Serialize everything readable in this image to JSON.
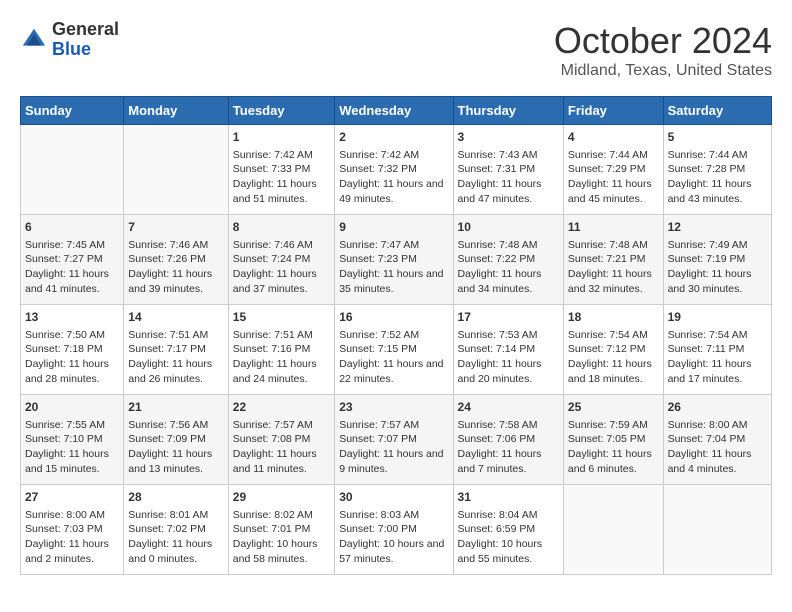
{
  "header": {
    "logo_general": "General",
    "logo_blue": "Blue",
    "month_title": "October 2024",
    "location": "Midland, Texas, United States"
  },
  "calendar": {
    "days_of_week": [
      "Sunday",
      "Monday",
      "Tuesday",
      "Wednesday",
      "Thursday",
      "Friday",
      "Saturday"
    ],
    "weeks": [
      [
        {
          "day": "",
          "content": ""
        },
        {
          "day": "",
          "content": ""
        },
        {
          "day": "1",
          "content": "Sunrise: 7:42 AM\nSunset: 7:33 PM\nDaylight: 11 hours and 51 minutes."
        },
        {
          "day": "2",
          "content": "Sunrise: 7:42 AM\nSunset: 7:32 PM\nDaylight: 11 hours and 49 minutes."
        },
        {
          "day": "3",
          "content": "Sunrise: 7:43 AM\nSunset: 7:31 PM\nDaylight: 11 hours and 47 minutes."
        },
        {
          "day": "4",
          "content": "Sunrise: 7:44 AM\nSunset: 7:29 PM\nDaylight: 11 hours and 45 minutes."
        },
        {
          "day": "5",
          "content": "Sunrise: 7:44 AM\nSunset: 7:28 PM\nDaylight: 11 hours and 43 minutes."
        }
      ],
      [
        {
          "day": "6",
          "content": "Sunrise: 7:45 AM\nSunset: 7:27 PM\nDaylight: 11 hours and 41 minutes."
        },
        {
          "day": "7",
          "content": "Sunrise: 7:46 AM\nSunset: 7:26 PM\nDaylight: 11 hours and 39 minutes."
        },
        {
          "day": "8",
          "content": "Sunrise: 7:46 AM\nSunset: 7:24 PM\nDaylight: 11 hours and 37 minutes."
        },
        {
          "day": "9",
          "content": "Sunrise: 7:47 AM\nSunset: 7:23 PM\nDaylight: 11 hours and 35 minutes."
        },
        {
          "day": "10",
          "content": "Sunrise: 7:48 AM\nSunset: 7:22 PM\nDaylight: 11 hours and 34 minutes."
        },
        {
          "day": "11",
          "content": "Sunrise: 7:48 AM\nSunset: 7:21 PM\nDaylight: 11 hours and 32 minutes."
        },
        {
          "day": "12",
          "content": "Sunrise: 7:49 AM\nSunset: 7:19 PM\nDaylight: 11 hours and 30 minutes."
        }
      ],
      [
        {
          "day": "13",
          "content": "Sunrise: 7:50 AM\nSunset: 7:18 PM\nDaylight: 11 hours and 28 minutes."
        },
        {
          "day": "14",
          "content": "Sunrise: 7:51 AM\nSunset: 7:17 PM\nDaylight: 11 hours and 26 minutes."
        },
        {
          "day": "15",
          "content": "Sunrise: 7:51 AM\nSunset: 7:16 PM\nDaylight: 11 hours and 24 minutes."
        },
        {
          "day": "16",
          "content": "Sunrise: 7:52 AM\nSunset: 7:15 PM\nDaylight: 11 hours and 22 minutes."
        },
        {
          "day": "17",
          "content": "Sunrise: 7:53 AM\nSunset: 7:14 PM\nDaylight: 11 hours and 20 minutes."
        },
        {
          "day": "18",
          "content": "Sunrise: 7:54 AM\nSunset: 7:12 PM\nDaylight: 11 hours and 18 minutes."
        },
        {
          "day": "19",
          "content": "Sunrise: 7:54 AM\nSunset: 7:11 PM\nDaylight: 11 hours and 17 minutes."
        }
      ],
      [
        {
          "day": "20",
          "content": "Sunrise: 7:55 AM\nSunset: 7:10 PM\nDaylight: 11 hours and 15 minutes."
        },
        {
          "day": "21",
          "content": "Sunrise: 7:56 AM\nSunset: 7:09 PM\nDaylight: 11 hours and 13 minutes."
        },
        {
          "day": "22",
          "content": "Sunrise: 7:57 AM\nSunset: 7:08 PM\nDaylight: 11 hours and 11 minutes."
        },
        {
          "day": "23",
          "content": "Sunrise: 7:57 AM\nSunset: 7:07 PM\nDaylight: 11 hours and 9 minutes."
        },
        {
          "day": "24",
          "content": "Sunrise: 7:58 AM\nSunset: 7:06 PM\nDaylight: 11 hours and 7 minutes."
        },
        {
          "day": "25",
          "content": "Sunrise: 7:59 AM\nSunset: 7:05 PM\nDaylight: 11 hours and 6 minutes."
        },
        {
          "day": "26",
          "content": "Sunrise: 8:00 AM\nSunset: 7:04 PM\nDaylight: 11 hours and 4 minutes."
        }
      ],
      [
        {
          "day": "27",
          "content": "Sunrise: 8:00 AM\nSunset: 7:03 PM\nDaylight: 11 hours and 2 minutes."
        },
        {
          "day": "28",
          "content": "Sunrise: 8:01 AM\nSunset: 7:02 PM\nDaylight: 11 hours and 0 minutes."
        },
        {
          "day": "29",
          "content": "Sunrise: 8:02 AM\nSunset: 7:01 PM\nDaylight: 10 hours and 58 minutes."
        },
        {
          "day": "30",
          "content": "Sunrise: 8:03 AM\nSunset: 7:00 PM\nDaylight: 10 hours and 57 minutes."
        },
        {
          "day": "31",
          "content": "Sunrise: 8:04 AM\nSunset: 6:59 PM\nDaylight: 10 hours and 55 minutes."
        },
        {
          "day": "",
          "content": ""
        },
        {
          "day": "",
          "content": ""
        }
      ]
    ]
  }
}
